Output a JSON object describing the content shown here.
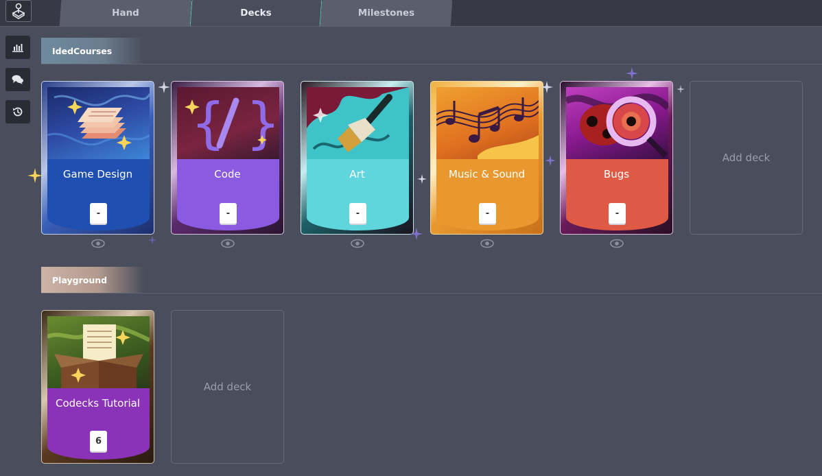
{
  "topbar": {
    "logo_icon": "joystick-icon",
    "tabs": [
      {
        "label": "Hand",
        "active": false
      },
      {
        "label": "Decks",
        "active": true
      },
      {
        "label": "Milestones",
        "active": false
      }
    ]
  },
  "sidebar": {
    "buttons": [
      {
        "icon": "bar-chart-icon"
      },
      {
        "icon": "chat-bubbles-icon"
      },
      {
        "icon": "history-icon"
      }
    ]
  },
  "sections": {
    "courses": {
      "label": "IdedCourses",
      "decks": [
        {
          "title": "Game Design",
          "badge": "-",
          "color": "#1f4fb0",
          "icon": "layered-pages-icon"
        },
        {
          "title": "Code",
          "badge": "-",
          "color": "#8a5ae0",
          "icon": "code-braces-icon"
        },
        {
          "title": "Art",
          "badge": "-",
          "color": "#5ed6dc",
          "icon": "paintbrush-icon"
        },
        {
          "title": "Music & Sound",
          "badge": "-",
          "color": "#e8982e",
          "icon": "music-notes-icon"
        },
        {
          "title": "Bugs",
          "badge": "-",
          "color": "#df5a45",
          "icon": "magnifier-bug-icon"
        }
      ],
      "add_label": "Add deck"
    },
    "playground": {
      "label": "Playground",
      "decks": [
        {
          "title": "Codecks Tutorial",
          "badge": "6",
          "color": "#8b33b8",
          "icon": "open-box-icon"
        }
      ],
      "add_label": "Add deck"
    }
  }
}
